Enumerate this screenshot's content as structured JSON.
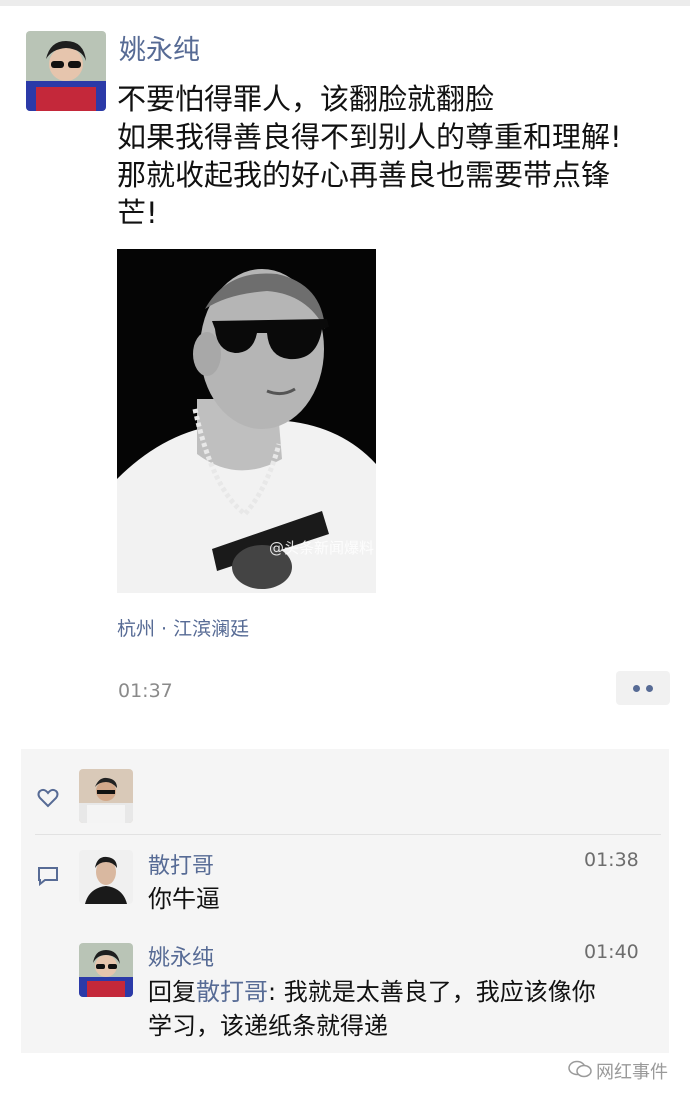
{
  "post": {
    "author": "姚永纯",
    "lines": [
      "不要怕得罪人，该翻脸就翻脸",
      "如果我得善良得不到别人的尊重和理解!",
      "那就收起我的好心再善良也需要带点锋",
      "芒!"
    ],
    "image_watermark": "@头条新闻爆料",
    "location": "杭州 · 江滨澜廷",
    "time": "01:37"
  },
  "comments": [
    {
      "author": "散打哥",
      "time": "01:38",
      "text": "你牛逼"
    },
    {
      "author": "姚永纯",
      "time": "01:40",
      "reply_prefix": "回复",
      "reply_to": "散打哥",
      "text_line1": ": 我就是太善良了，我应该像你",
      "text_line2": "学习，该递纸条就得递"
    }
  ],
  "watermark": "网红事件",
  "icons": {
    "like": "heart-icon",
    "comment": "comment-bubble-icon",
    "more": "more-dots-icon",
    "brand": "wechat-logo-icon"
  },
  "colors": {
    "name_link": "#576b95",
    "panel_bg": "#f5f5f5"
  }
}
